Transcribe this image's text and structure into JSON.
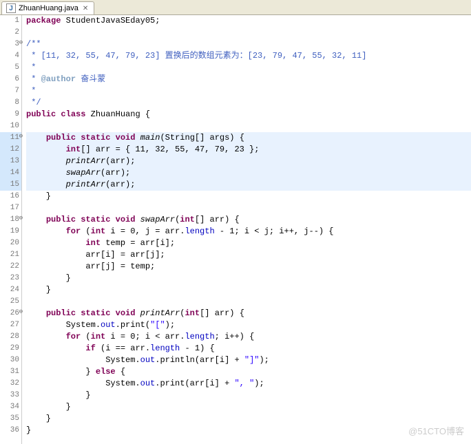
{
  "tab": {
    "filename": "ZhuanHuang.java",
    "close_symbol": "✕"
  },
  "gutter": {
    "lines": [
      {
        "n": "1"
      },
      {
        "n": "2"
      },
      {
        "n": "3",
        "fold": "⊖"
      },
      {
        "n": "4"
      },
      {
        "n": "5"
      },
      {
        "n": "6"
      },
      {
        "n": "7"
      },
      {
        "n": "8"
      },
      {
        "n": "9"
      },
      {
        "n": "10"
      },
      {
        "n": "11",
        "hl": true,
        "fold": "⊖"
      },
      {
        "n": "12",
        "hl": true
      },
      {
        "n": "13",
        "hl": true
      },
      {
        "n": "14",
        "hl": true
      },
      {
        "n": "15",
        "hl": true
      },
      {
        "n": "16"
      },
      {
        "n": "17"
      },
      {
        "n": "18",
        "fold": "⊖"
      },
      {
        "n": "19"
      },
      {
        "n": "20"
      },
      {
        "n": "21"
      },
      {
        "n": "22"
      },
      {
        "n": "23"
      },
      {
        "n": "24"
      },
      {
        "n": "25"
      },
      {
        "n": "26",
        "fold": "⊖"
      },
      {
        "n": "27"
      },
      {
        "n": "28"
      },
      {
        "n": "29"
      },
      {
        "n": "30"
      },
      {
        "n": "31"
      },
      {
        "n": "32"
      },
      {
        "n": "33"
      },
      {
        "n": "34"
      },
      {
        "n": "35"
      },
      {
        "n": "36"
      }
    ]
  },
  "code": {
    "l1_kw1": "package",
    "l1_txt": " StudentJavaSEday05;",
    "l3": "/**",
    "l4": " * [11, 32, 55, 47, 79, 23] 置换后的数组元素为：[23, 79, 47, 55, 32, 11]",
    "l5": " * ",
    "l6a": " * ",
    "l6tag": "@author",
    "l6b": " 奋斗蒙",
    "l7": " * ",
    "l8": " */",
    "l9_kw1": "public",
    "l9_kw2": "class",
    "l9_txt": " ZhuanHuang {",
    "l11_kw1": "public",
    "l11_kw2": "static",
    "l11_kw3": "void",
    "l11_fn": " main",
    "l11_txt": "(String[] args) {",
    "l12_kw1": "int",
    "l12_txt": "[] arr = { 11, 32, 55, 47, 79, 23 };",
    "l13_fn": "printArr",
    "l13_txt": "(arr);",
    "l14_fn": "swapArr",
    "l14_txt": "(arr);",
    "l15_fn": "printArr",
    "l15_txt": "(arr);",
    "l16": "    }",
    "l18_kw1": "public",
    "l18_kw2": "static",
    "l18_kw3": "void",
    "l18_fn": " swapArr",
    "l18_kw4": "int",
    "l18_txt1": "(",
    "l18_txt2": "[] arr) {",
    "l19_kw1": "for",
    "l19_kw2": "int",
    "l19_txt1": " (",
    "l19_txt2": " i = 0, j = arr.",
    "l19_fld": "length",
    "l19_txt3": " - 1; i < j; i++, j--) {",
    "l20_kw1": "int",
    "l20_txt": " temp = arr[i];",
    "l21": "            arr[i] = arr[j];",
    "l22": "            arr[j] = temp;",
    "l23": "        }",
    "l24": "    }",
    "l26_kw1": "public",
    "l26_kw2": "static",
    "l26_kw3": "void",
    "l26_fn": " printArr",
    "l26_kw4": "int",
    "l26_txt1": "(",
    "l26_txt2": "[] arr) {",
    "l27_txt1": "        System.",
    "l27_fld": "out",
    "l27_txt2": ".print(",
    "l27_str": "\"[\"",
    "l27_txt3": ");",
    "l28_kw1": "for",
    "l28_kw2": "int",
    "l28_txt1": " (",
    "l28_txt2": " i = 0; i < arr.",
    "l28_fld": "length",
    "l28_txt3": "; i++) {",
    "l29_kw1": "if",
    "l29_txt1": " (i == arr.",
    "l29_fld": "length",
    "l29_txt2": " - 1) {",
    "l30_txt1": "                System.",
    "l30_fld": "out",
    "l30_txt2": ".println(arr[i] + ",
    "l30_str": "\"]\"",
    "l30_txt3": ");",
    "l31_txt1": "            } ",
    "l31_kw1": "else",
    "l31_txt2": " {",
    "l32_txt1": "                System.",
    "l32_fld": "out",
    "l32_txt2": ".print(arr[i] + ",
    "l32_str": "\", \"",
    "l32_txt3": ");",
    "l33": "            }",
    "l34": "        }",
    "l35": "    }",
    "l36": "}"
  },
  "watermark": "@51CTO博客"
}
